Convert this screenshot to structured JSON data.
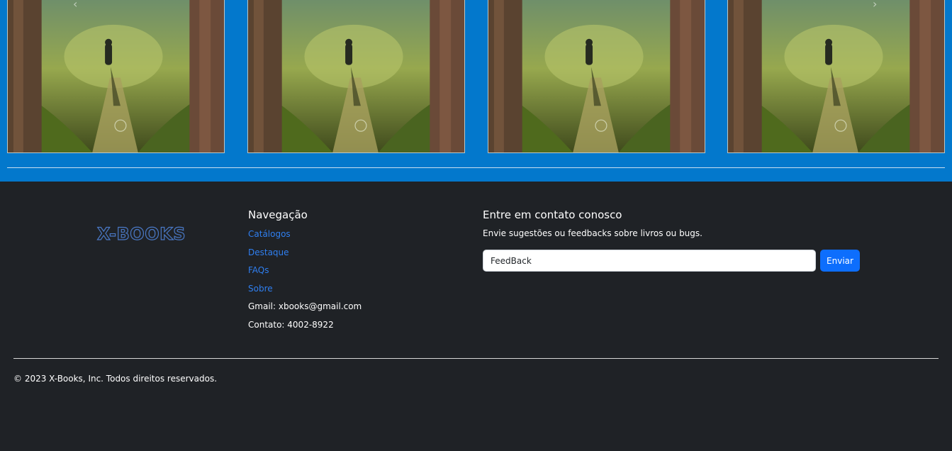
{
  "carousel": {
    "books": [
      {
        "cover": "forest-path-book-cover"
      },
      {
        "cover": "forest-path-book-cover"
      },
      {
        "cover": "forest-path-book-cover"
      },
      {
        "cover": "forest-path-book-cover"
      }
    ],
    "prev_icon": "chevron-left-icon",
    "next_icon": "chevron-right-icon",
    "background_color": "#0378cc"
  },
  "footer": {
    "logo": "X-BOOKS",
    "navigation": {
      "title": "Navegação",
      "links": [
        "Catálogos",
        "Destaque",
        "FAQs",
        "Sobre"
      ],
      "email": "Gmail: xbooks@gmail.com",
      "phone": "Contato: 4002-8922"
    },
    "contact": {
      "title": "Entre em contato conosco",
      "subtitle": "Envie sugestões ou feedbacks sobre livros ou bugs.",
      "input_value": "FeedBack",
      "button_label": "Enviar"
    },
    "copyright": "© 2023 X-Books, Inc. Todos direitos reservados."
  },
  "colors": {
    "footer_bg": "#1f2226",
    "link": "#2f7ff0",
    "button": "#0d6efd"
  }
}
